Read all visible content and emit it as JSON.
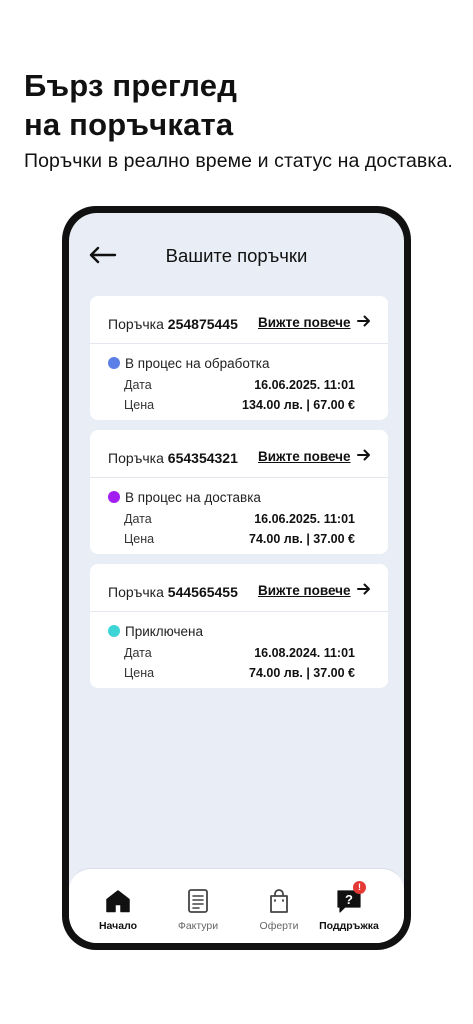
{
  "promo": {
    "title_line1": "Бърз преглед",
    "title_line2": "на поръчката",
    "subtitle": "Поръчки в реално време и статус на доставка."
  },
  "header": {
    "back_icon": "arrow-left-icon",
    "title": "Вашите поръчки"
  },
  "orders": [
    {
      "label": "Поръчка",
      "number": "254875445",
      "view_more": "Вижте повече",
      "status": "В процес на обработка",
      "status_color": "#5b7fe6",
      "date_label": "Дата",
      "date": "16.06.2025. 11:01",
      "price_label": "Цена",
      "price": "134.00 лв. | 67.00 €"
    },
    {
      "label": "Поръчка",
      "number": "654354321",
      "view_more": "Вижте повече",
      "status": "В процес на доставка",
      "status_color": "#a31ef0",
      "date_label": "Дата",
      "date": "16.06.2025. 11:01",
      "price_label": "Цена",
      "price": "74.00 лв. | 37.00 €"
    },
    {
      "label": "Поръчка",
      "number": "544565455",
      "view_more": "Вижте повече",
      "status": "Приключена",
      "status_color": "#3dd4d6",
      "date_label": "Дата",
      "date": "16.08.2024. 11:01",
      "price_label": "Цена",
      "price": "74.00 лв. | 37.00 €"
    }
  ],
  "bottom_nav": {
    "items": [
      {
        "label": "Начало",
        "icon": "home-icon",
        "active": true
      },
      {
        "label": "Фактури",
        "icon": "document-icon",
        "active": false
      },
      {
        "label": "Оферти",
        "icon": "shopping-bag-icon",
        "active": false
      },
      {
        "label": "Поддръжка",
        "icon": "support-chat-icon",
        "active": true,
        "badge": "!"
      }
    ]
  },
  "colors": {
    "screen_bg": "#e9edf6",
    "notification_badge": "#e53935"
  }
}
